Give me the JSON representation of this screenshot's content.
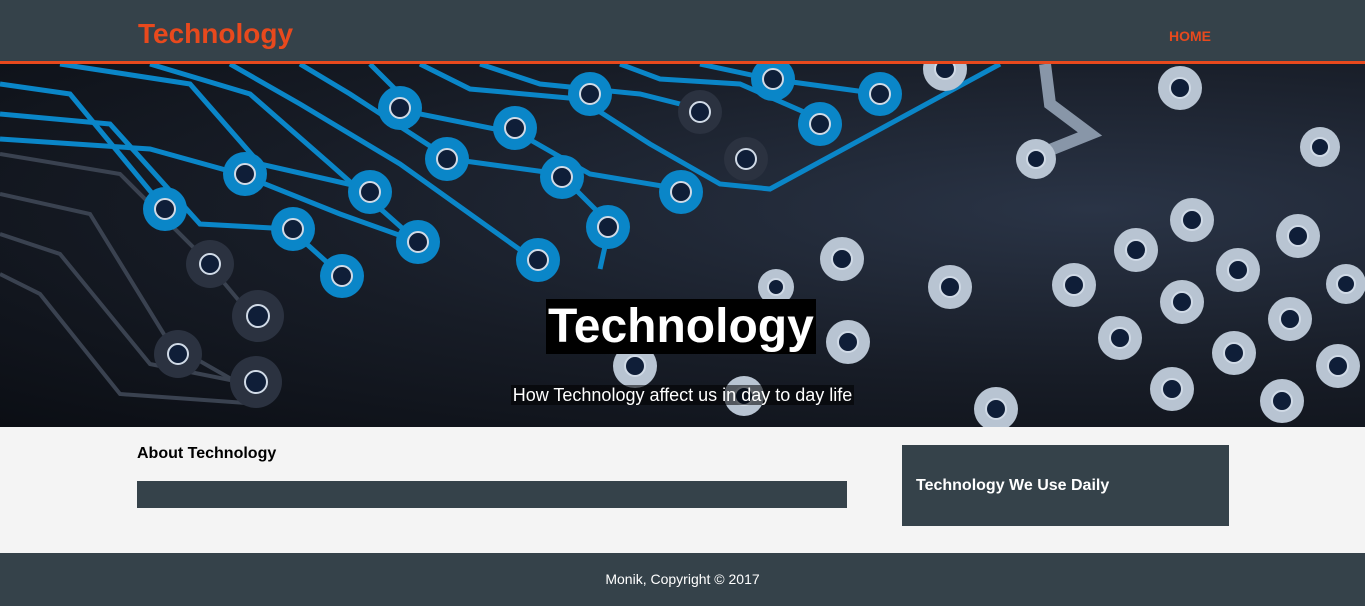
{
  "header": {
    "logo": "Technology",
    "nav": {
      "home_label": "HOME"
    }
  },
  "hero": {
    "title": "Technology",
    "subtitle": "How Technology affect us in day to day life"
  },
  "main": {
    "about_heading": "About Technology"
  },
  "sidebar": {
    "heading": "Technology We Use Daily"
  },
  "footer": {
    "copyright": "Monik, Copyright © 2017"
  },
  "colors": {
    "header_bg": "#35424a",
    "accent": "#e8491d",
    "page_bg": "#f4f4f4",
    "circuit_trace": "#0a86c8"
  }
}
